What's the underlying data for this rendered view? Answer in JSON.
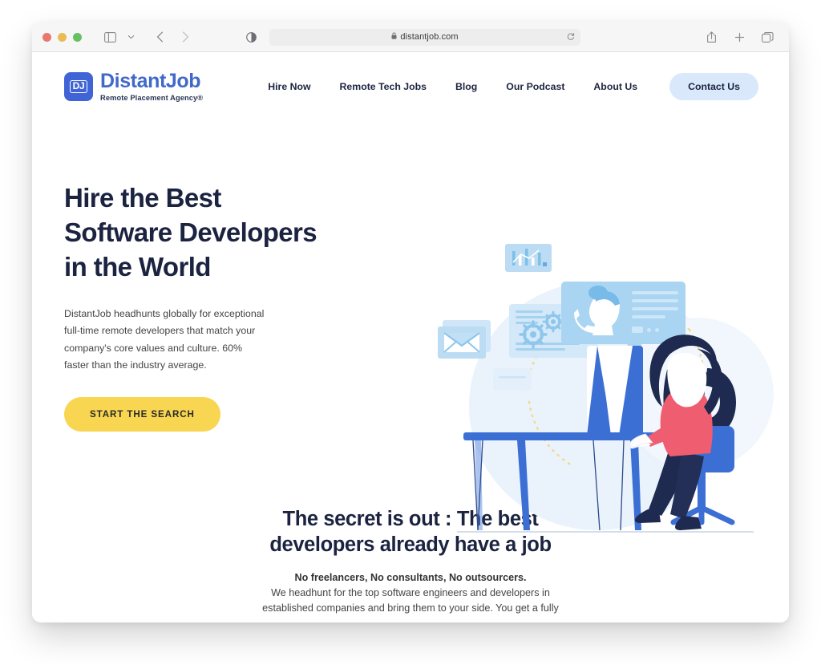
{
  "browser": {
    "traffic_lights": [
      "close",
      "minimize",
      "maximize"
    ],
    "sidebar_icon": "sidebar-icon",
    "sidebar_chevron_icon": "chevron-down-icon",
    "back_icon": "back-arrow-icon",
    "forward_icon": "forward-arrow-icon",
    "privacy_icon": "contrast-circle-icon",
    "lock_icon": "lock-icon",
    "url": "distantjob.com",
    "reload_icon": "reload-icon",
    "share_icon": "share-icon",
    "new_tab_icon": "plus-icon",
    "tabs_icon": "tab-overview-icon"
  },
  "site": {
    "logo": {
      "mark_text": "DJ",
      "name": "DistantJob",
      "tagline": "Remote Placement Agency®",
      "mark_color": "#4064d6",
      "name_color": "#4169c9"
    },
    "nav": [
      {
        "label": "Hire Now"
      },
      {
        "label": "Remote Tech Jobs"
      },
      {
        "label": "Blog"
      },
      {
        "label": "Our Podcast"
      },
      {
        "label": "About Us"
      }
    ],
    "nav_cta": {
      "label": "Contact Us",
      "background": "#d9e8fa",
      "text_color": "#1d2440"
    }
  },
  "hero": {
    "title_line1": "Hire the Best",
    "title_line2": "Software Developers",
    "title_line3": "in the World",
    "paragraph": "DistantJob headhunts globally for exceptional full-time remote developers that match your company's core values and culture. 60% faster than the industry average.",
    "cta_label": "START THE SEARCH",
    "cta_color": "#f8d651",
    "illustration": "woman-at-desk-illustration"
  },
  "secret": {
    "title_line1": "The secret is out : The best",
    "title_line2": "developers already have a job",
    "lead": "No freelancers, No consultants, No outsourcers.",
    "body_line1": "We headhunt for the top software engineers and developers in",
    "body_line2": "established companies and bring them to your side. You get a fully"
  },
  "colors": {
    "navy": "#1b2340",
    "brand_blue": "#4169c9",
    "accent_yellow": "#f8d651",
    "illustration_blue": "#3b6fd4",
    "illustration_pink": "#ef5d71"
  }
}
